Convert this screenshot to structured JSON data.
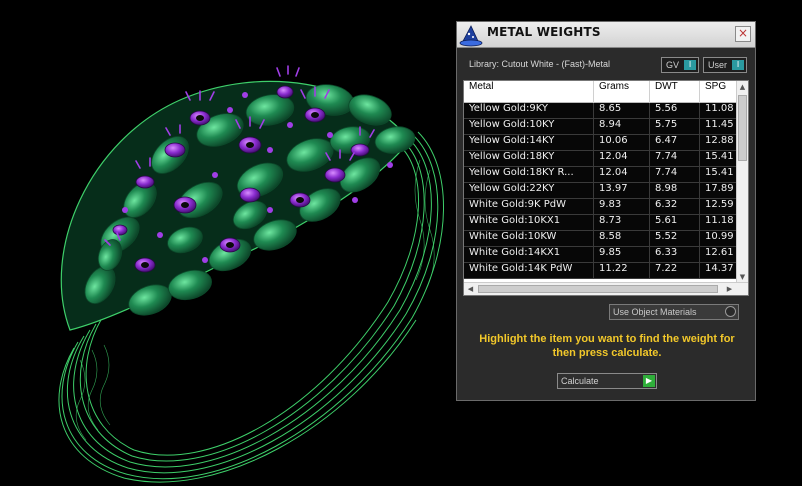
{
  "panel": {
    "title": "METAL WEIGHTS",
    "close_glyph": "×",
    "library_label": "Library: Cutout White - (Fast)-Metal",
    "toggles": [
      {
        "label": "GV",
        "knob": "I"
      },
      {
        "label": "User",
        "knob": "I"
      }
    ],
    "table": {
      "headers": [
        "Metal",
        "Grams",
        "DWT",
        "SPG"
      ],
      "rows": [
        [
          "Yellow Gold:9KY",
          "8.65",
          "5.56",
          "11.08"
        ],
        [
          "Yellow Gold:10KY",
          "8.94",
          "5.75",
          "11.45"
        ],
        [
          "Yellow Gold:14KY",
          "10.06",
          "6.47",
          "12.88"
        ],
        [
          "Yellow Gold:18KY",
          "12.04",
          "7.74",
          "15.41"
        ],
        [
          "Yellow Gold:18KY R...",
          "12.04",
          "7.74",
          "15.41"
        ],
        [
          "Yellow Gold:22KY",
          "13.97",
          "8.98",
          "17.89"
        ],
        [
          "White Gold:9K PdW",
          "9.83",
          "6.32",
          "12.59"
        ],
        [
          "White Gold:10KX1",
          "8.73",
          "5.61",
          "11.18"
        ],
        [
          "White Gold:10KW",
          "8.58",
          "5.52",
          "10.99"
        ],
        [
          "White Gold:14KX1",
          "9.85",
          "6.33",
          "12.61"
        ],
        [
          "White Gold:14K PdW",
          "11.22",
          "7.22",
          "14.37"
        ]
      ]
    },
    "use_object_materials": "Use Object Materials",
    "hint": "Highlight the item you want to find the weight for then press calculate.",
    "calculate_label": "Calculate",
    "calculate_icon": "play-arrow-icon",
    "colors": {
      "hint": "#f2c82a",
      "toggle_knob": "#2a9aa0",
      "calculate_arrow": "#2fae3a",
      "bracelet_wire": "#3ecf6a",
      "bracelet_fill": "#1f8a52",
      "accent_purple": "#8a2ccf"
    }
  }
}
